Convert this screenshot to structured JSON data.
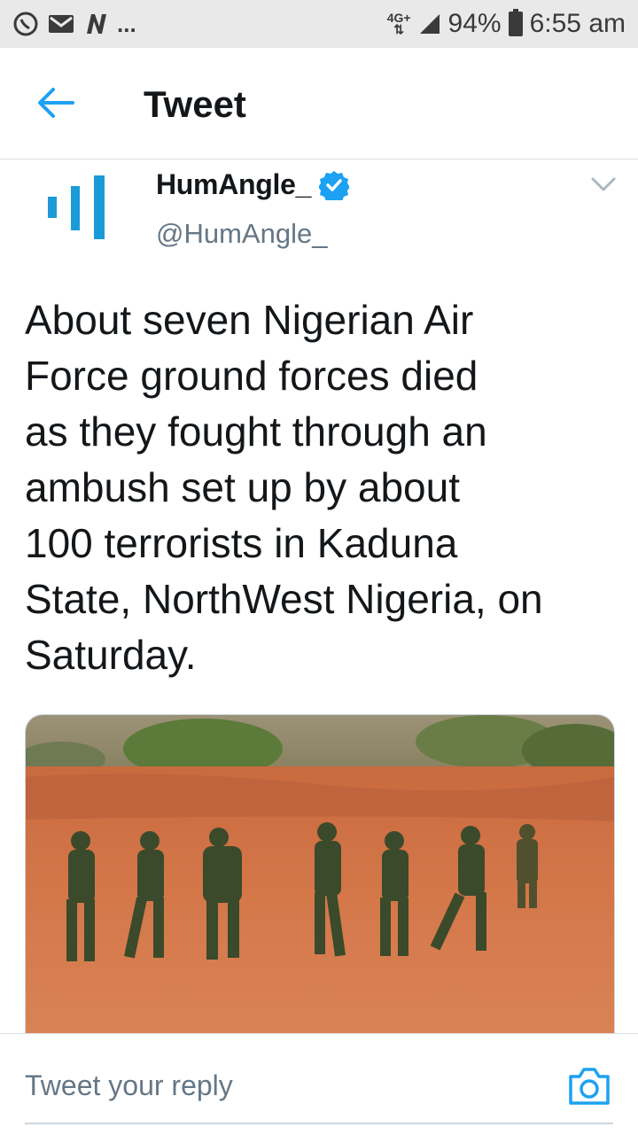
{
  "status_bar": {
    "left_icons": [
      "viber-icon",
      "mail-icon",
      "n-app-icon"
    ],
    "more": "...",
    "network": "4G+",
    "battery_percent": "94%",
    "time": "6:55 am"
  },
  "header": {
    "title": "Tweet"
  },
  "tweet": {
    "display_name": "HumAngle_",
    "handle": "@HumAngle_",
    "verified": true,
    "text": "About seven Nigerian Air\nForce ground forces died\nas they fought through an\nambush set up by about\n100 terrorists in Kaduna\nState, NorthWest Nigeria, on\nSaturday."
  },
  "reply": {
    "placeholder": "Tweet your reply"
  },
  "colors": {
    "twitter_blue": "#1da1f2",
    "humangle_blue": "#1b9ad8",
    "secondary_text": "#657786"
  }
}
